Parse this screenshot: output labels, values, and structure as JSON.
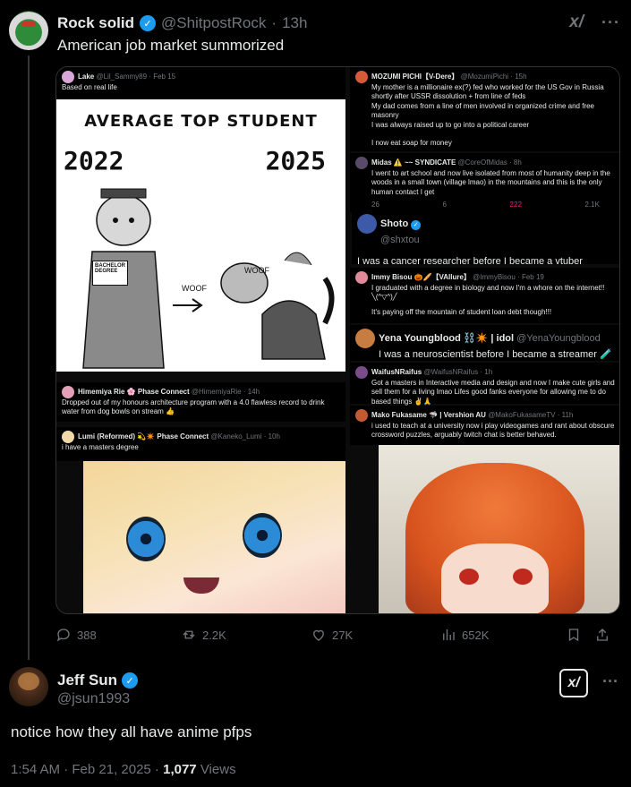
{
  "quoted_post": {
    "author": "Rock solid",
    "handle": "@ShitpostRock",
    "time": "13h",
    "text": "American job market summorized",
    "media": {
      "lake": {
        "name": "Lake",
        "handle": "@Lil_Sammy89",
        "date": "Feb 15",
        "text": "Based on real life"
      },
      "comic": {
        "title": "AVERAGE TOP STUDENT",
        "year_left": "2022",
        "year_right": "2025",
        "diploma": "BACHELOR DEGREE",
        "woof1": "WOOF",
        "woof2": "WOOF"
      },
      "mozumi": {
        "name": "MOZUMI PICHI【V-Dere】",
        "handle": "@MozumiPichi",
        "time": "15h",
        "text": "My mother is a millionaire ex(?) fed who worked for the US Gov in Russia shortly after USSR dissolution + from line of feds\nMy dad comes from a line of men involved in organized crime and free masonry\nI was always raised up to go into a political career\n\nI now eat soap for money"
      },
      "midas": {
        "name": "Midas ⚠️ ~~ SYNDICATE",
        "handle": "@CoreOfMidas",
        "time": "8h",
        "text": "I went to art school and now live isolated from most of humanity deep in the woods in a small town (village lmao) in the mountains and this is the only human contact I get",
        "stats": [
          "26",
          "6",
          "222",
          "2.1K"
        ]
      },
      "shoto": {
        "name": "Shoto",
        "handle": "@shxtou",
        "text": "I was a cancer researcher before I became a vtuber"
      },
      "immy": {
        "name": "Immy Bisou 🎃🥖【VAllure】",
        "handle": "@ImmyBisou",
        "date": "Feb 19",
        "text": "I graduated with a degree in biology and now I'm a whore on the internet!! ╲(^▽^)╱",
        "text2": "It's paying off the mountain of student loan debt though!!!"
      },
      "yena": {
        "name": "Yena Youngblood ⛓️✴️ | idol",
        "handle": "@YenaYoungblood",
        "text": "I was a neuroscientist before I became a streamer 🧪"
      },
      "waifus": {
        "name": "WaifusNRaifus",
        "handle": "@WaifusNRaifus",
        "time": "1h",
        "text": "Got a masters in Interactive media and design and now I make cute girls and sell them for a living lmao Lifes good fanks everyone for allowing me to do based things ✌️🙏"
      },
      "mako": {
        "name": "Mako Fukasame 🦈 | Vershion AU",
        "handle": "@MakoFukasameTV",
        "time": "11h",
        "text": "i used to teach at a university now i play videogames and rant about obscure crossword puzzles, arguably twitch chat is better behaved."
      },
      "himemiya": {
        "name": "Himemiya Rie 🌸 Phase Connect",
        "handle": "@HimemiyaRie",
        "time": "14h",
        "text": "Dropped out of my honours architecture program with a 4.0 flawless record to drink water from dog bowls on stream 👍"
      },
      "lumi": {
        "name": "Lumi (Reformed) 💫✴️ Phase Connect",
        "handle": "@Kaneko_Lumi",
        "time": "10h",
        "text": "i have a masters degree"
      }
    },
    "actions": {
      "replies": "388",
      "reposts": "2.2K",
      "likes": "27K",
      "views": "652K"
    }
  },
  "main_post": {
    "author": "Jeff Sun",
    "handle": "@jsun1993",
    "text": "notice how they all have anime pfps",
    "timestamp": "1:54 AM · Feb 21, 2025 · ",
    "views_count": "1,077",
    "views_label": " Views"
  },
  "colors": {
    "accent": "#1d9bf0",
    "muted": "#71767b",
    "text": "#e7e9ea",
    "background": "#000000"
  }
}
